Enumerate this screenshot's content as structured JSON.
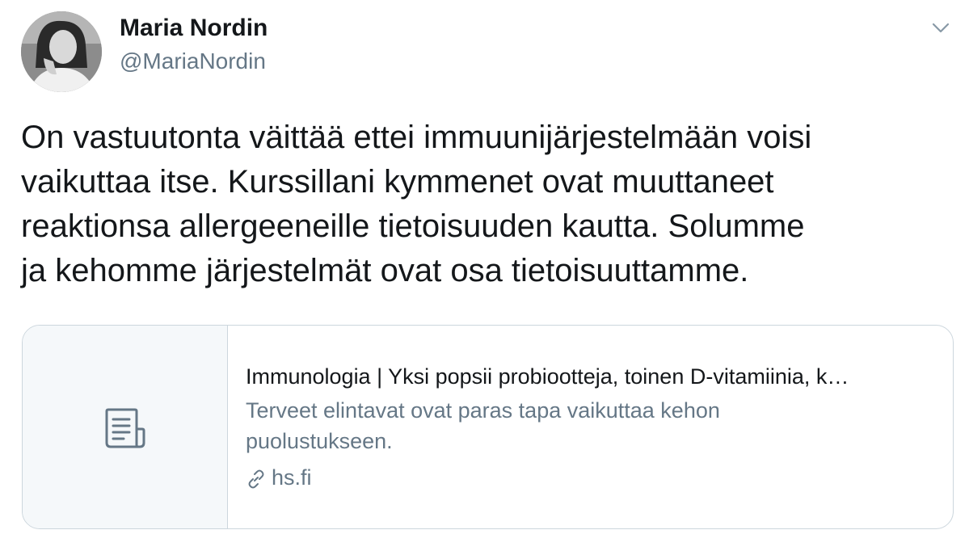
{
  "author": {
    "name": "Maria Nordin",
    "handle": "@MariaNordin"
  },
  "tweet": {
    "lines": [
      "On vastuutonta väittää ettei immuunijärjestelmään voisi",
      "vaikuttaa itse. Kurssillani kymmenet ovat muuttaneet",
      "reaktionsa allergeeneille tietoisuuden kautta. Solumme",
      "ja kehomme järjestelmät ovat osa tietoisuuttamme."
    ]
  },
  "card": {
    "title": "Immunologia | Yksi popsii probiootteja, toinen D-vitamiinia, k…",
    "description_lines": [
      "Terveet elintavat ovat paras tapa vaikuttaa kehon",
      "puolustukseen."
    ],
    "domain": "hs.fi",
    "thumb_icon": "document-icon"
  },
  "icons": {
    "menu": "chevron-down-icon",
    "link": "link-icon"
  },
  "colors": {
    "text_primary": "#14171a",
    "text_secondary": "#657786",
    "border": "#ccd6dd",
    "thumb_bg": "#f5f8fa"
  }
}
